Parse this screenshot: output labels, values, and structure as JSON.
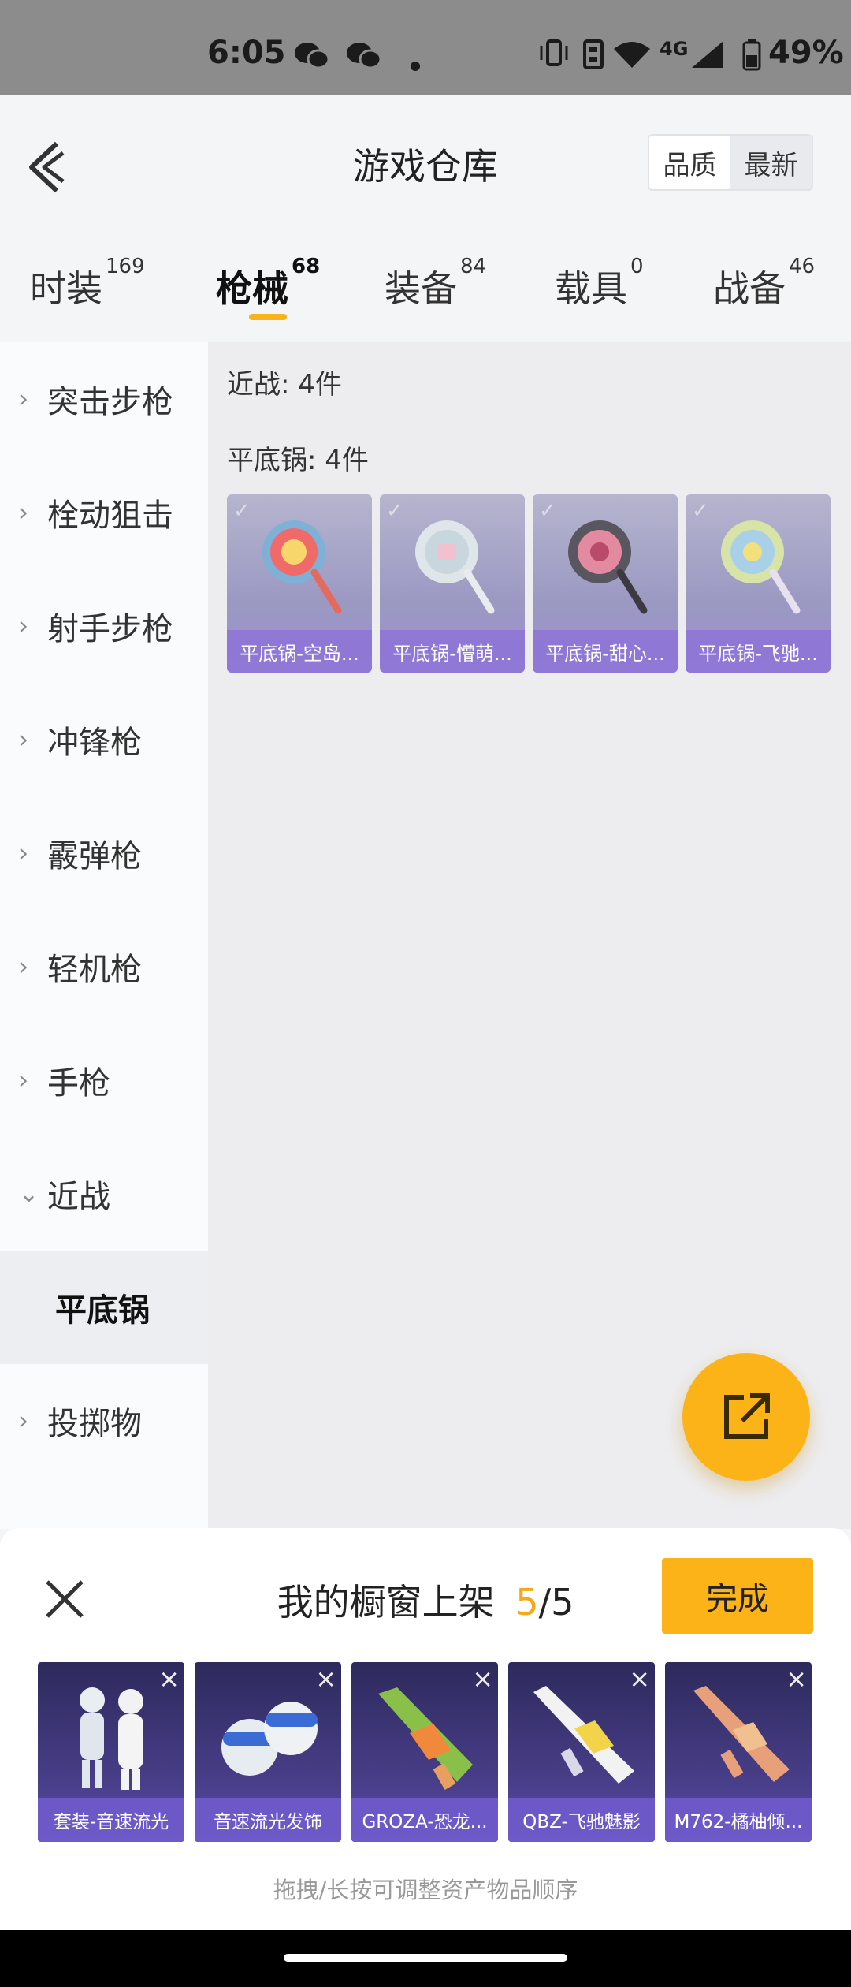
{
  "status_bar": {
    "time": "6:05",
    "network": "4G",
    "battery": "49%",
    "icons": [
      "wechat-icon",
      "wechat-icon",
      "dot-icon",
      "vibrate-icon",
      "sim-icon",
      "wifi-icon",
      "signal-icon",
      "battery-icon"
    ]
  },
  "header": {
    "title": "游戏仓库",
    "sort_options": [
      "品质",
      "最新"
    ],
    "sort_selected": "品质"
  },
  "tabs": [
    {
      "label": "时装",
      "count": "169"
    },
    {
      "label": "枪械",
      "count": "68",
      "active": true
    },
    {
      "label": "装备",
      "count": "84"
    },
    {
      "label": "载具",
      "count": "0"
    },
    {
      "label": "战备",
      "count": "46"
    }
  ],
  "sidebar": {
    "items": [
      {
        "label": "突击步枪",
        "icon": "chevron-right-icon"
      },
      {
        "label": "栓动狙击",
        "icon": "chevron-right-icon"
      },
      {
        "label": "射手步枪",
        "icon": "chevron-right-icon"
      },
      {
        "label": "冲锋枪",
        "icon": "chevron-right-icon"
      },
      {
        "label": "霰弹枪",
        "icon": "chevron-right-icon"
      },
      {
        "label": "轻机枪",
        "icon": "chevron-right-icon"
      },
      {
        "label": "手枪",
        "icon": "chevron-right-icon"
      },
      {
        "label": "近战",
        "icon": "chevron-down-icon"
      },
      {
        "label": "平底锅",
        "selected": true
      },
      {
        "label": "投掷物",
        "icon": "chevron-right-icon"
      }
    ]
  },
  "content": {
    "category_label": "近战: 4件",
    "subcategory_label": "平底锅: 4件",
    "items": [
      {
        "name": "平底锅-空岛..."
      },
      {
        "name": "平底锅-懵萌..."
      },
      {
        "name": "平底锅-甜心..."
      },
      {
        "name": "平底锅-飞驰..."
      }
    ]
  },
  "fab": {
    "icon": "share-icon"
  },
  "showcase": {
    "title": "我的橱窗上架",
    "count": "5",
    "sep": "/",
    "total": "5",
    "done_label": "完成",
    "items": [
      {
        "name": "套装-音速流光"
      },
      {
        "name": "音速流光发饰"
      },
      {
        "name": "GROZA-恐龙..."
      },
      {
        "name": "QBZ-飞驰魅影"
      },
      {
        "name": "M762-橘柚倾..."
      }
    ],
    "hint": "拖拽/长按可调整资产物品顺序"
  },
  "colors": {
    "accent": "#fbb318",
    "card_purple": "#8e76d6"
  }
}
